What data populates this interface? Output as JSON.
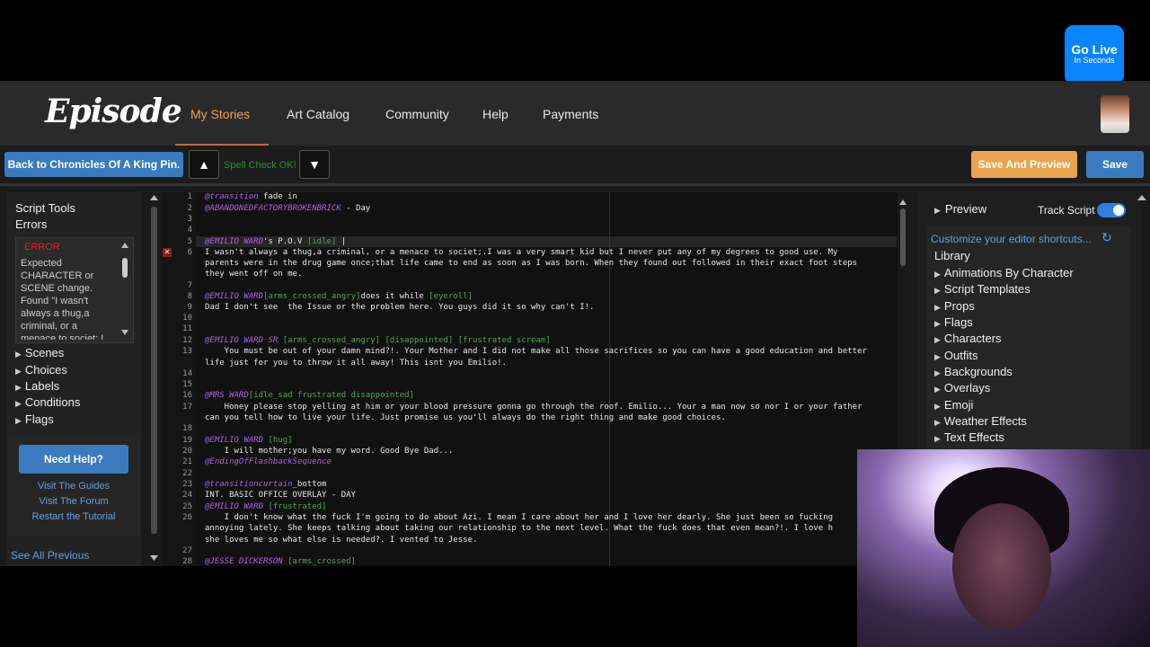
{
  "golive": {
    "big": "Go Live",
    "small": "In Seconds"
  },
  "nav": {
    "logo": "Episode",
    "links": [
      "My Stories",
      "Art Catalog",
      "Community",
      "Help",
      "Payments"
    ]
  },
  "toolbar": {
    "back_label": "Back to Chronicles Of A King Pin.",
    "up_icon": "▲",
    "down_icon": "▼",
    "spell_status": "Spell Check OK!",
    "save_preview_label": "Save And Preview",
    "save_label": "Save"
  },
  "left": {
    "script_tools": "Script Tools",
    "errors": "Errors",
    "error_label": "ERROR",
    "error_message": "Expected CHARACTER or SCENE change. Found \"I wasn't always a thug,a criminal, or a menace to societ; I",
    "items": [
      "Scenes",
      "Choices",
      "Labels",
      "Conditions",
      "Flags"
    ],
    "need_help": "Need Help?",
    "help_links": [
      "Visit The Guides",
      "Visit The Forum",
      "Restart the Tutorial"
    ],
    "see_all": "See All Previous"
  },
  "editor": {
    "line_numbers": [
      "1",
      "2",
      "3",
      "4",
      "5",
      "6",
      "",
      "7",
      "8",
      "9",
      "10",
      "11",
      "12",
      "13",
      "",
      "14",
      "15",
      "16",
      "17",
      "",
      "18",
      "19",
      "20",
      "21",
      "22",
      "23",
      "24",
      "25",
      "26",
      "",
      "",
      "27",
      "28"
    ],
    "l1_cmd": "@transition",
    "l1_rest": " fade in",
    "l2_cmd": "@ABANDONEDFACTORYBROKENBRICK",
    "l2_rest": " - Day",
    "l5_cmd": "@EMILIO WARD",
    "l5_rest": "'s P.O.V ",
    "l5_anim": "[idle]",
    "l5_cursor": " |",
    "l6a": "I wasn't always a thug,a criminal, or a menace to societ;.I was a very smart kid but I never put any of my degrees to good use. My",
    "l6b": "parents were in the drug game once;that life came to end as soon as I was born. When they found out followed in their exact foot steps",
    "l6c": "they went off on me.",
    "l8_cmd": "@EMILIO WARD",
    "l8_anim1": "[arms_crossed_angry]",
    "l8_mid": "does it while ",
    "l8_anim2": "[eyeroll]",
    "l9": "Dad I don't see  the Issue or the problem here. You guys did it so why can't I!.",
    "l12_cmd": "@EMILIO WARD SR",
    "l12_anim": " [arms_crossed_angry] [disappointed] [frustrated scream]",
    "l13a": "    You must be out of your damn mind?!. Your Mother and I did not make all those sacrifices so you can have a good education and better",
    "l13b": "life just for you to throw it all away! This isnt you Emilio!.",
    "l16_cmd": "@MRS WARD",
    "l16_anim": "[idle_sad frustrated disappointed]",
    "l17a": "    Honey please stop yelling at him or your blood pressure gonna go through the roof. Emilio... Your a man now so nor I or your father",
    "l17b": "can you tell how to live your life. Just promise us you'll always do the right thing and make good choices.",
    "l19_cmd": "@EMILIO WARD",
    "l19_anim": " [hug]",
    "l20": "    I will mother;you have my word. Good Bye Dad...",
    "l21_cmd": "@EndingOfFlashbackSequence",
    "l23_cmd": "@transitioncurtain",
    "l23_rest": "_bottom",
    "l24": "INT. BASIC OFFICE OVERLAY - DAY",
    "l25_cmd": "@EMILIO WARD",
    "l25_anim": " [frustrated]",
    "l26a": "    I don't know what the fuck I'm going to do about Azi. I mean I care about her and I love her dearly. She just been so fucking",
    "l26b": "annoying lately. She keeps talking about taking our relationship to the next level. What the fuck does that even mean?!. I love h",
    "l26c": "she loves me so what else is needed?. I vented to Jesse.",
    "l28_cmd": "@JESSE DICKERSON",
    "l28_anim": " [arms_crossed]"
  },
  "right": {
    "preview": "Preview",
    "track_script": "Track Script",
    "customize": "Customize your editor shortcuts...",
    "library": "Library",
    "items": [
      "Animations By Character",
      "Script Templates",
      "Props",
      "Flags",
      "Characters",
      "Outfits",
      "Backgrounds",
      "Overlays",
      "Emoji",
      "Weather Effects",
      "Text Effects"
    ]
  },
  "colors": {
    "accent_orange": "#f0a052",
    "button_blue": "#3a7bbf",
    "command_purple": "#b05ee0",
    "anim_green": "#4ea74e",
    "error_red": "#e02020"
  }
}
